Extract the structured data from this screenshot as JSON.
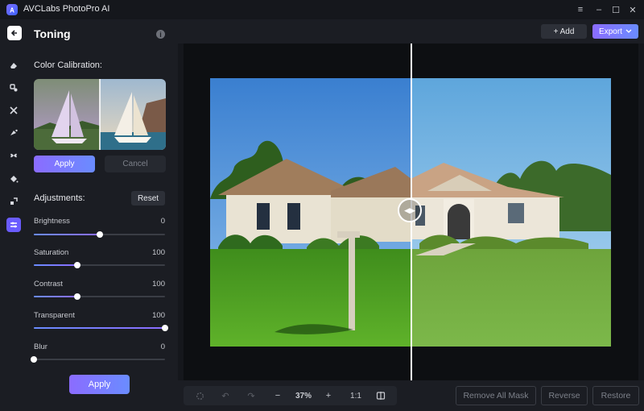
{
  "app": {
    "title": "AVCLabs PhotoPro AI"
  },
  "window": {
    "menu_icon": "hamburger-icon",
    "minimize_icon": "minimize-icon",
    "maximize_icon": "maximize-icon",
    "close_icon": "close-icon"
  },
  "rail": {
    "items": [
      {
        "name": "eraser-icon"
      },
      {
        "name": "face-retouch-icon"
      },
      {
        "name": "enhance-icon"
      },
      {
        "name": "colorize-icon"
      },
      {
        "name": "remove-background-icon"
      },
      {
        "name": "fill-icon"
      },
      {
        "name": "resize-icon"
      },
      {
        "name": "toning-icon",
        "active": true
      }
    ]
  },
  "panel": {
    "title": "Toning",
    "color_calibration_label": "Color Calibration:",
    "apply_label": "Apply",
    "cancel_label": "Cancel",
    "adjustments_label": "Adjustments:",
    "reset_label": "Reset",
    "sliders": [
      {
        "label": "Brightness",
        "value": "0",
        "fraction": 0.5
      },
      {
        "label": "Saturation",
        "value": "100",
        "fraction": 0.33
      },
      {
        "label": "Contrast",
        "value": "100",
        "fraction": 0.33
      },
      {
        "label": "Transparent",
        "value": "100",
        "fraction": 1.0
      },
      {
        "label": "Blur",
        "value": "0",
        "fraction": 0.0
      }
    ],
    "bottom_apply_label": "Apply"
  },
  "header": {
    "add_label": "+ Add",
    "export_label": "Export"
  },
  "toolbar": {
    "zoom": "37%",
    "ratio_label": "1:1",
    "remove_all_mask_label": "Remove All Mask",
    "reverse_label": "Reverse",
    "restore_label": "Restore"
  },
  "colors": {
    "accent": "#6a5cff",
    "gradient_start": "#8b6cff",
    "gradient_end": "#6a8cff"
  }
}
